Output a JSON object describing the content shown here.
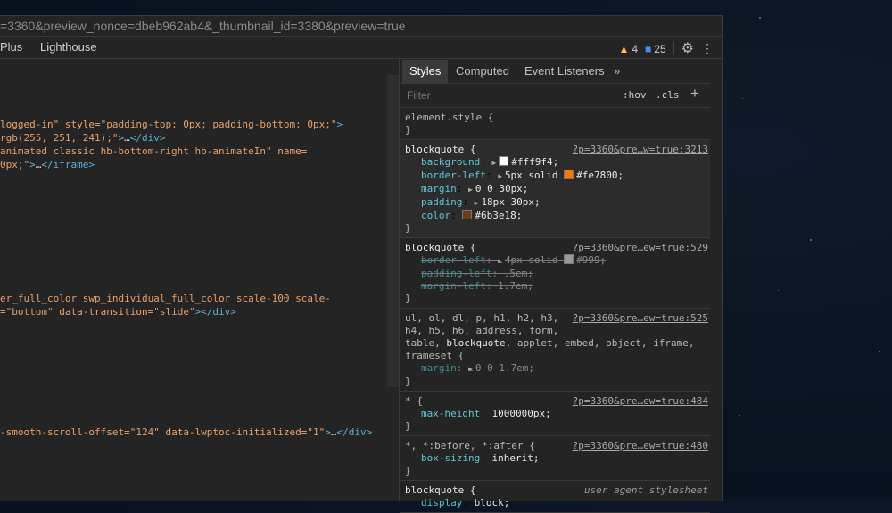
{
  "url": "=3360&preview_nonce=dbeb962ab4&_thumbnail_id=3380&preview=true",
  "tabbar": {
    "tab_plus": "Plus",
    "tab_lighthouse": "Lighthouse",
    "warn_count": "4",
    "msg_count": "25",
    "icons": [
      "warning-icon",
      "message-icon",
      "gear-icon",
      "kebab-icon"
    ]
  },
  "elements": [
    {
      "parts": [
        {
          "c": "attr",
          "t": "logged-in\""
        },
        {
          "c": "attr",
          "t": " style="
        },
        {
          "c": "val",
          "t": "\"padding-top: 0px; padding-bottom: 0px;\""
        },
        {
          "c": "tag",
          "t": ">"
        }
      ]
    },
    {
      "parts": [
        {
          "c": "val",
          "t": "rgb(255, 251, 241);\""
        },
        {
          "c": "tag",
          "t": ">"
        },
        {
          "c": "txt",
          "t": "…"
        },
        {
          "c": "tag",
          "t": "</div>"
        }
      ]
    },
    {
      "parts": [
        {
          "c": "val",
          "t": "animated classic hb-bottom-right hb-animateIn\""
        },
        {
          "c": "attr",
          "t": " name="
        }
      ]
    },
    {
      "parts": [
        {
          "c": "val",
          "t": "0px;\""
        },
        {
          "c": "tag",
          "t": ">"
        },
        {
          "c": "txt",
          "t": "…"
        },
        {
          "c": "tag",
          "t": "</iframe>"
        }
      ]
    },
    {
      "parts": [
        {
          "c": "val",
          "t": "er_full_color swp_individual_full_color scale-100 scale-"
        }
      ]
    },
    {
      "parts": [
        {
          "c": "attr",
          "t": "="
        },
        {
          "c": "val",
          "t": "\"bottom\""
        },
        {
          "c": "attr",
          "t": " data-transition="
        },
        {
          "c": "val",
          "t": "\"slide\""
        },
        {
          "c": "tag",
          "t": "></div>"
        }
      ]
    },
    {
      "parts": [
        {
          "c": "attr",
          "t": "-smooth-scroll-offset="
        },
        {
          "c": "val",
          "t": "\"124\""
        },
        {
          "c": "attr",
          "t": " data-lwptoc-initialized="
        },
        {
          "c": "val",
          "t": "\"1\""
        },
        {
          "c": "tag",
          "t": ">"
        },
        {
          "c": "txt",
          "t": "…"
        },
        {
          "c": "tag",
          "t": "</div>"
        }
      ]
    }
  ],
  "styles": {
    "tabs": [
      "Styles",
      "Computed",
      "Event Listeners",
      "»"
    ],
    "filter_placeholder": "Filter",
    "hov": ":hov",
    "cls": ".cls",
    "plus": "+",
    "element_style": "element.style {",
    "close_brace": "}",
    "rules": [
      {
        "selector": "blockquote {",
        "source": "?p=3360&pre…w=true:3213",
        "highlight": true,
        "decls": [
          {
            "prop": "background",
            "sep": ": ",
            "tri": true,
            "swatch": "#fff9f4",
            "value": "#fff9f4;"
          },
          {
            "prop": "border-left",
            "sep": ": ",
            "tri": true,
            "value": "5px solid ",
            "swatch2": "#fe7800",
            "value2": "#fe7800;"
          },
          {
            "prop": "margin",
            "sep": ": ",
            "tri": true,
            "value": "0 0 30px;"
          },
          {
            "prop": "padding",
            "sep": ": ",
            "tri": true,
            "value": "18px 30px;"
          },
          {
            "prop": "color",
            "sep": ": ",
            "swatch": "#6b3e18",
            "value": "#6b3e18;"
          }
        ]
      },
      {
        "selector": "blockquote {",
        "source": "?p=3360&pre…ew=true:529",
        "decls": [
          {
            "prop": "border-left",
            "sep": ": ",
            "tri": true,
            "value": "4px solid ",
            "swatch2": "#999999",
            "value2": "#999;",
            "strike": true
          },
          {
            "prop": "padding-left",
            "sep": ": ",
            "value": ".5em;",
            "strike": true
          },
          {
            "prop": "margin-left",
            "sep": ": ",
            "value": "1.7em;",
            "strike": true
          }
        ]
      },
      {
        "selector_lines": [
          "ul, ol, dl, p, h1, h2, h3,",
          "h4, h5, h6, address, form,",
          "table, blockquote, applet, embed, object, iframe,",
          "frameset {"
        ],
        "source": "?p=3360&pre…ew=true:525",
        "decls": [
          {
            "prop": "margin",
            "sep": ": ",
            "tri": true,
            "value": "0 0 1.7em;",
            "strike": true
          }
        ]
      },
      {
        "selector": "* {",
        "source": "?p=3360&pre…ew=true:484",
        "decls": [
          {
            "prop": "max-height",
            "sep": ": ",
            "value": "1000000px;"
          }
        ]
      },
      {
        "selector": "*, *:before, *:after {",
        "source": "?p=3360&pre…ew=true:480",
        "decls": [
          {
            "prop": "box-sizing",
            "sep": ": ",
            "value": "inherit;"
          }
        ]
      },
      {
        "selector": "blockquote {",
        "source": "user agent stylesheet",
        "ua": true,
        "decls": [
          {
            "prop": "display",
            "sep": ": ",
            "value": "block;"
          }
        ]
      }
    ]
  }
}
